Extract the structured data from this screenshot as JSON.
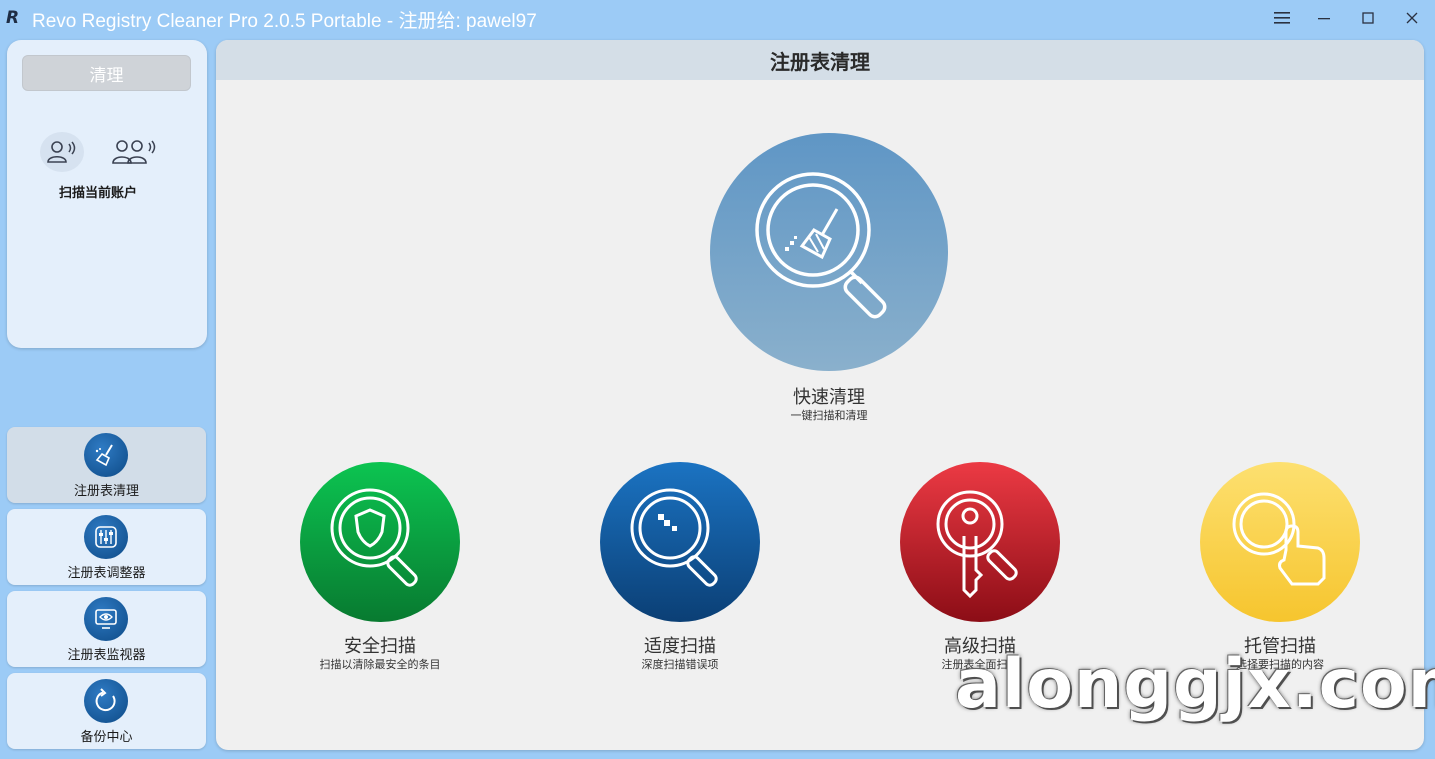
{
  "window": {
    "logo": "R",
    "title": "Revo Registry Cleaner Pro 2.0.5 Portable - 注册给: pawel97"
  },
  "controls": {
    "menu_icon": "hamburger-icon",
    "minimize_icon": "minimize-icon",
    "maximize_icon": "maximize-icon",
    "close_icon": "close-icon"
  },
  "left_panel": {
    "clean_button": "清理",
    "scan_current_account": "扫描当前账户"
  },
  "nav": [
    {
      "label": "注册表清理",
      "icon": "broom-icon",
      "active": true
    },
    {
      "label": "注册表调整器",
      "icon": "sliders-icon",
      "active": false
    },
    {
      "label": "注册表监视器",
      "icon": "monitor-eye-icon",
      "active": false
    },
    {
      "label": "备份中心",
      "icon": "restore-icon",
      "active": false
    }
  ],
  "main": {
    "header": "注册表清理",
    "quick": {
      "title": "快速清理",
      "subtitle": "一键扫描和清理"
    },
    "cards": [
      {
        "title": "安全扫描",
        "subtitle": "扫描以清除最安全的条目",
        "color": "#0a9d3c"
      },
      {
        "title": "适度扫描",
        "subtitle": "深度扫描错误项",
        "color": "#0f5ea4"
      },
      {
        "title": "高级扫描",
        "subtitle": "注册表全面扫描",
        "color": "#c11e2b"
      },
      {
        "title": "托管扫描",
        "subtitle": "选择要扫描的内容",
        "color": "#f7c93a"
      }
    ]
  },
  "watermark": "alonggjx.com"
}
